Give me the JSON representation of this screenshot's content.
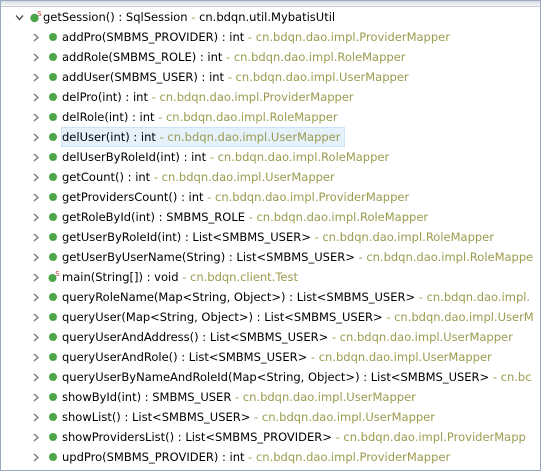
{
  "tree": {
    "root": {
      "signature": "getSession() : SqlSession",
      "owner": "cn.bdqn.util.MybatisUtil"
    },
    "items": [
      {
        "signature": "addPro(SMBMS_PROVIDER) : int",
        "owner": "cn.bdqn.dao.impl.ProviderMapper"
      },
      {
        "signature": "addRole(SMBMS_ROLE) : int",
        "owner": "cn.bdqn.dao.impl.RoleMapper"
      },
      {
        "signature": "addUser(SMBMS_USER) : int",
        "owner": "cn.bdqn.dao.impl.UserMapper"
      },
      {
        "signature": "delPro(int) : int",
        "owner": "cn.bdqn.dao.impl.ProviderMapper"
      },
      {
        "signature": "delRole(int) : int",
        "owner": "cn.bdqn.dao.impl.RoleMapper"
      },
      {
        "signature": "delUser(int) : int",
        "owner": "cn.bdqn.dao.impl.UserMapper"
      },
      {
        "signature": "delUserByRoleId(int) : int",
        "owner": "cn.bdqn.dao.impl.RoleMapper"
      },
      {
        "signature": "getCount() : int",
        "owner": "cn.bdqn.dao.impl.UserMapper"
      },
      {
        "signature": "getProvidersCount() : int",
        "owner": "cn.bdqn.dao.impl.ProviderMapper"
      },
      {
        "signature": "getRoleById(int) : SMBMS_ROLE",
        "owner": "cn.bdqn.dao.impl.RoleMapper"
      },
      {
        "signature": "getUserByRoleId(int) : List<SMBMS_USER>",
        "owner": "cn.bdqn.dao.impl.RoleMapper"
      },
      {
        "signature": "getUserByUserName(String) : List<SMBMS_USER>",
        "owner": "cn.bdqn.dao.impl.RoleMappe"
      },
      {
        "signature": "main(String[]) : void",
        "owner": "cn.bdqn.client.Test"
      },
      {
        "signature": "queryRoleName(Map<String, Object>) : List<SMBMS_USER>",
        "owner": "cn.bdqn.dao.impl."
      },
      {
        "signature": "queryUser(Map<String, Object>) : List<SMBMS_USER>",
        "owner": "cn.bdqn.dao.impl.UserM"
      },
      {
        "signature": "queryUserAndAddress() : List<SMBMS_USER>",
        "owner": "cn.bdqn.dao.impl.UserMapper"
      },
      {
        "signature": "queryUserAndRole() : List<SMBMS_USER>",
        "owner": "cn.bdqn.dao.impl.UserMapper"
      },
      {
        "signature": "queryUserByNameAndRoleId(Map<String, Object>) : List<SMBMS_USER>",
        "owner": "cn.bc"
      },
      {
        "signature": "showById(int) : SMBMS_USER",
        "owner": "cn.bdqn.dao.impl.UserMapper"
      },
      {
        "signature": "showList() : List<SMBMS_USER>",
        "owner": "cn.bdqn.dao.impl.UserMapper"
      },
      {
        "signature": "showProvidersList() : List<SMBMS_PROVIDER>",
        "owner": "cn.bdqn.dao.impl.ProviderMapp"
      },
      {
        "signature": "updPro(SMBMS_PROVIDER) : int",
        "owner": "cn.bdqn.dao.impl.ProviderMapper"
      }
    ],
    "separator": " - ",
    "selected_index": 5,
    "static_index": 12
  },
  "colors": {
    "method_public": "#4aa648",
    "owner_text": "#9b9b4f",
    "selection": "#e5f1fb",
    "twisty": "#7a7a7a"
  },
  "icons": {
    "expand": "chevron-right-icon",
    "collapse": "chevron-down-icon",
    "method": "public-method-icon",
    "static_method": "static-method-icon"
  }
}
